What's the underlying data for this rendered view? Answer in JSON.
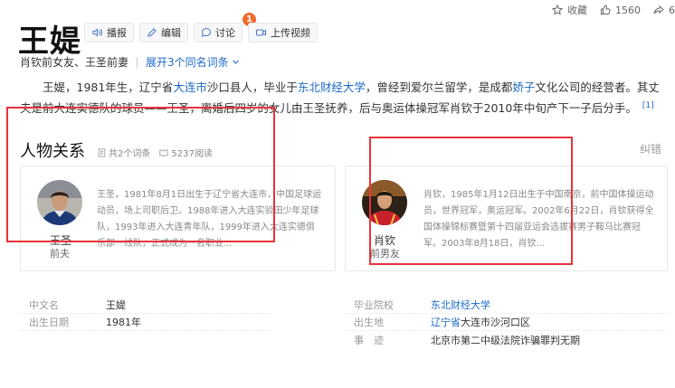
{
  "topbar": {
    "collect_label": "收藏",
    "like_count": "1560",
    "share_count": "6"
  },
  "title": "王媞",
  "title_buttons": [
    {
      "label": "播报"
    },
    {
      "label": "编辑"
    },
    {
      "label": "讨论",
      "badge": "1"
    },
    {
      "label": "上传视频"
    }
  ],
  "subtitle": {
    "desc": "肖钦前女友、王圣前妻",
    "expand": "展开3个同名词条"
  },
  "summary": {
    "p1": "王媞，1981年生，辽宁省",
    "l1": "大连市",
    "p2": "沙口县人，毕业于",
    "l2": "东北财经大学",
    "p3": "，曾经到爱尔兰留学，是成都",
    "l3": "娇子",
    "p4": "文化公司的经营者。其丈夫是前大连实德队的球员——王圣，离婚后四岁的女儿由王圣抚养，后与奥运体操冠军肖钦于2010年中旬产下一子后分手。",
    "ref": "[1]"
  },
  "relations": {
    "title": "人物关系",
    "entries": "共2个词条",
    "reads": "5237阅读",
    "correct": "纠错",
    "people": [
      {
        "name": "王圣",
        "relation": "前夫",
        "desc": "王圣，1981年8月1日出生于辽宁省大连市，中国足球运动员，场上司职后卫。1988年进入大连实验田少年足球队，1993年进入大连青年队，1999年进入大连实德俱乐部一线队，正式成为一名职业..."
      },
      {
        "name": "肖钦",
        "relation": "前男友",
        "desc": "肖钦，1985年1月12日出生于中国南京，前中国体操运动员，世界冠军，奥运冠军。2002年6月22日，肖钦获得全国体操锦标赛暨第十四届亚运会选拔赛男子鞍马比赛冠军。2003年8月18日，肖钦..."
      }
    ]
  },
  "basic_info": {
    "left": [
      {
        "key": "中文名",
        "value": "王媞"
      },
      {
        "key": "出生日期",
        "value": "1981年"
      }
    ],
    "right": [
      {
        "key": "毕业院校",
        "value": "东北财经大学"
      },
      {
        "key": "出生地",
        "link": "辽宁省",
        "value": "大连市沙河口区"
      },
      {
        "key": "事　迹",
        "value": "北京市第二中级法院诈骗罪判无期"
      }
    ]
  },
  "colors": {
    "link": "#1e69c8",
    "highlight_box": "#e8333a",
    "badge": "#f26b2d"
  }
}
